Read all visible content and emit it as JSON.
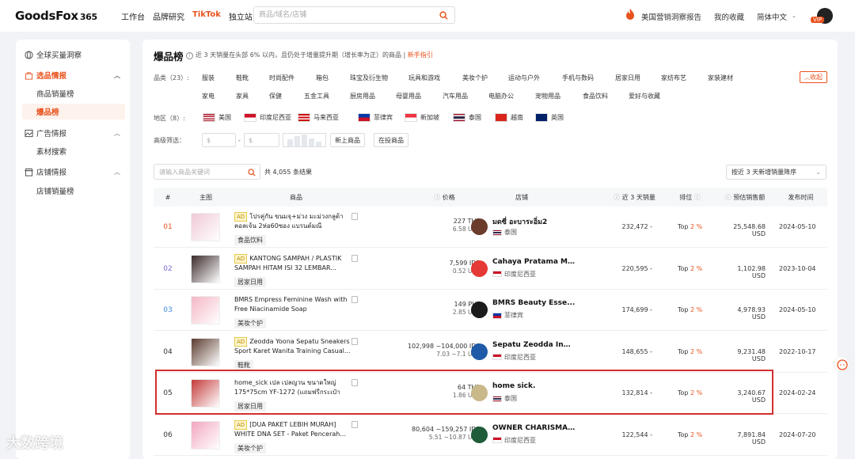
{
  "header": {
    "logo": "GoodsFox",
    "logo_sup": "365",
    "nav": [
      "工作台",
      "品牌研究",
      "TikTok",
      "独立站"
    ],
    "search_placeholder": "商品/域名/店铺",
    "report": "美国营销洞察报告",
    "favorites": "我的收藏",
    "lang": "简体中文",
    "vip": "VIP"
  },
  "sidebar": {
    "top": "全球买量洞察",
    "groups": [
      {
        "label": "选品情报",
        "items": [
          "商品销量榜",
          "爆品榜"
        ]
      },
      {
        "label": "广告情报",
        "items": [
          "素材搜索"
        ]
      },
      {
        "label": "店铺情报",
        "items": [
          "店铺销量榜"
        ]
      }
    ]
  },
  "page": {
    "title": "爆品榜",
    "desc": "近 3 天销量在头部 6% 以内，且仍处于增量提升期（增长率为正）的商品",
    "guide": "新手指引",
    "collapse": "收起"
  },
  "filters": {
    "category_label": "品类（23）:",
    "categories_row1": [
      "服装",
      "鞋靴",
      "时尚配件",
      "箱包",
      "珠宝及衍生物",
      "玩具和游戏",
      "美妆个护",
      "运动与户外",
      "手机与数码",
      "居家日用",
      "家纺布艺",
      "家装建材"
    ],
    "categories_row2": [
      "家电",
      "家具",
      "保健",
      "五金工具",
      "厨房用品",
      "母婴用品",
      "汽车用品",
      "电脑办公",
      "宠物用品",
      "食品饮料",
      "爱好与收藏"
    ],
    "region_label": "地区（8）:",
    "regions": [
      "美国",
      "印度尼西亚",
      "马来西亚",
      "菲律宾",
      "新加坡",
      "泰国",
      "越南",
      "英国"
    ],
    "advanced_label": "高级筛选：",
    "price_min": "$",
    "price_dash": "-",
    "price_max": "$",
    "new_product": "新上商品",
    "advertising": "在投商品"
  },
  "toolbar": {
    "keyword_placeholder": "请输入商品关键词",
    "total": "共 4,055 条结果",
    "sort": "按近 3 天新增销量降序"
  },
  "table": {
    "headers": {
      "rank": "#",
      "image": "主图",
      "product": "商品",
      "price": "价格",
      "shop": "店铺",
      "sales": "近 3 天销量",
      "ranking": "排位",
      "revenue": "预估销售额",
      "date": "发布时间"
    },
    "rows": [
      {
        "rank": "01",
        "ad": "AD",
        "name": "โปรคู่กัน ขนมจุ+ม่วง มะม่วงกลูต้าคอลเจ้น 2ห่อ60ซอง แบรนด์มณี",
        "tag": "食品饮料",
        "price": "227 THB",
        "price_usd": "6.58 USD",
        "shop": "มดซี่ อะบาระอิ่ม2",
        "country": "泰国",
        "sales": "232,472 -",
        "top": "Top ",
        "pct": "2 %",
        "revenue": "25,548.68 USD",
        "date": "2024-05-10"
      },
      {
        "rank": "02",
        "ad": "AD",
        "name": "KANTONG SAMPAH / PLASTIK SAMPAH HITAM ISI 32 LEMBAR...",
        "tag": "居家日用",
        "price": "7,599 IDR",
        "price_usd": "0.52 USD",
        "shop": "Cahaya Pratama Mart",
        "country": "印度尼西亚",
        "sales": "220,595 -",
        "top": "Top ",
        "pct": "2 %",
        "revenue": "1,102.98 USD",
        "date": "2023-10-04"
      },
      {
        "rank": "03",
        "ad": "",
        "name": "BMRS Empress Feminine Wash with Free Niacinamide Soap",
        "tag": "美妆个护",
        "price": "149 PHP",
        "price_usd": "2.85 USD",
        "shop": "BMRS Beauty Esse...",
        "country": "菲律宾",
        "sales": "174,699 -",
        "top": "Top ",
        "pct": "2 %",
        "revenue": "4,978.93 USD",
        "date": "2024-05-10"
      },
      {
        "rank": "04",
        "ad": "AD",
        "name": "Zeodda Yoona Sepatu Sneakers Sport Karet Wanita Training Casual...",
        "tag": "鞋靴",
        "price": "102,998 ~104,000 IDR",
        "price_usd": "7.03 ~7.1 USD",
        "shop": "Sepatu Zeodda Indo...",
        "country": "印度尼西亚",
        "sales": "148,655 -",
        "top": "Top ",
        "pct": "2 %",
        "revenue": "9,231.48 USD",
        "date": "2022-10-17"
      },
      {
        "rank": "05",
        "ad": "",
        "name": "home_sick เปล เปลญวน ขนาดใหญ่ 175*75cm YF-1272 (แถมฟรีกระเป๋าและ...",
        "tag": "居家日用",
        "price": "64 THB",
        "price_usd": "1.86 USD",
        "shop": "home sick.",
        "country": "泰国",
        "sales": "132,814 -",
        "top": "Top ",
        "pct": "2 %",
        "revenue": "3,240.67 USD",
        "date": "2024-02-24"
      },
      {
        "rank": "06",
        "ad": "AD",
        "name": "[DUA PAKET LEBIH MURAH] WHITE DNA SET - Paket Pencerah...",
        "tag": "美妆个护",
        "price": "80,604 ~159,257 IDR",
        "price_usd": "5.51 ~10.87 USD",
        "shop": "OWNER CHARISMA...",
        "country": "印度尼西亚",
        "sales": "122,544 -",
        "top": "Top ",
        "pct": "2 %",
        "revenue": "7,891.84 USD",
        "date": "2024-07-20"
      }
    ]
  },
  "watermark": "大数跨境",
  "colors": {
    "accent": "#e8521d",
    "highlight": "#d32f2f"
  }
}
